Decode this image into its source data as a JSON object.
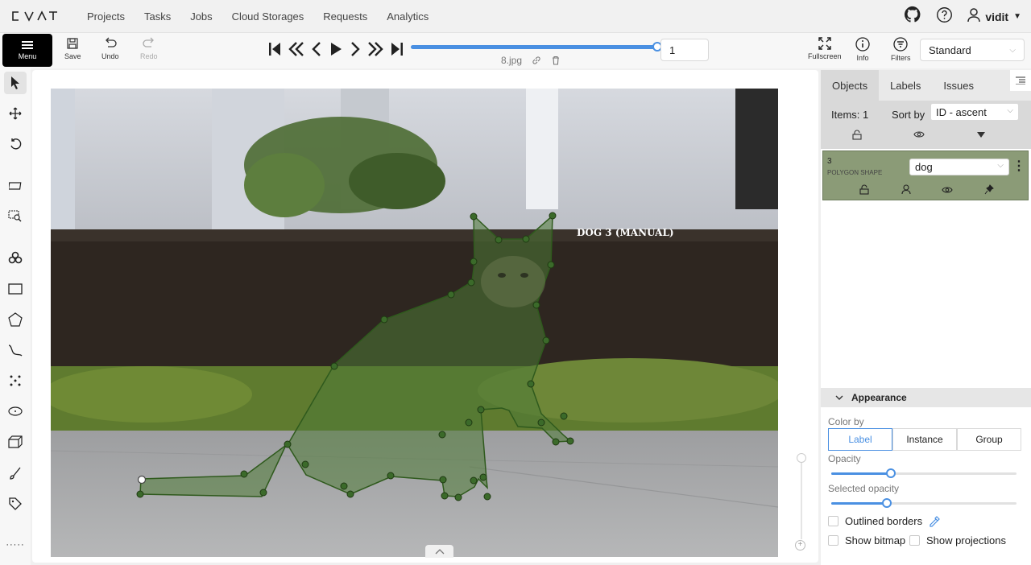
{
  "nav": {
    "links": [
      "Projects",
      "Tasks",
      "Jobs",
      "Cloud Storages",
      "Requests",
      "Analytics"
    ],
    "user": "vidit"
  },
  "toolbar": {
    "menu_label": "Menu",
    "save_label": "Save",
    "undo_label": "Undo",
    "redo_label": "Redo",
    "frame_number": "1",
    "filename": "8.jpg",
    "fullscreen_label": "Fullscreen",
    "info_label": "Info",
    "filters_label": "Filters",
    "workspace": "Standard"
  },
  "canvas": {
    "object_label": "DOG 3 (MANUAL)",
    "polygon_color": "#4f7a37"
  },
  "sidebar": {
    "tabs": [
      "Objects",
      "Labels",
      "Issues"
    ],
    "items_count_label": "Items: 1",
    "sort_by_label": "Sort by",
    "sort_value": "ID - ascent",
    "object": {
      "id": "3",
      "type": "POLYGON SHAPE",
      "label": "dog"
    }
  },
  "appearance": {
    "title": "Appearance",
    "color_by_label": "Color by",
    "color_by_options": [
      "Label",
      "Instance",
      "Group"
    ],
    "color_by_selected": "Label",
    "opacity_label": "Opacity",
    "opacity_value": 0.32,
    "selected_opacity_label": "Selected opacity",
    "selected_opacity_value": 0.3,
    "outlined_borders_label": "Outlined borders",
    "show_bitmap_label": "Show bitmap",
    "show_projections_label": "Show projections"
  },
  "colors": {
    "accent": "#4a90e2",
    "object_card": "#8b9b77"
  }
}
